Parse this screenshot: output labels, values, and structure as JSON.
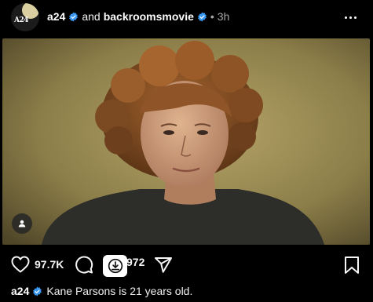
{
  "post": {
    "author": "a24",
    "avatar_logo": "A24",
    "joiner": "and",
    "coauthor": "backroomsmovie",
    "time": "3h",
    "icons": {
      "verified": "verified-badge-icon",
      "more": "more-options-icon",
      "user_tag": "user-tag-icon",
      "like": "heart-icon",
      "comment": "comment-icon",
      "download": "download-icon",
      "share": "share-icon",
      "save": "bookmark-icon"
    },
    "colors": {
      "verified": "#3897f0",
      "background": "#000000",
      "muted": "#a8a8a8"
    }
  },
  "actions": {
    "likes": "97.7K",
    "comments": "972"
  },
  "caption": {
    "author": "a24",
    "text": "Kane Parsons is 21 years old."
  }
}
